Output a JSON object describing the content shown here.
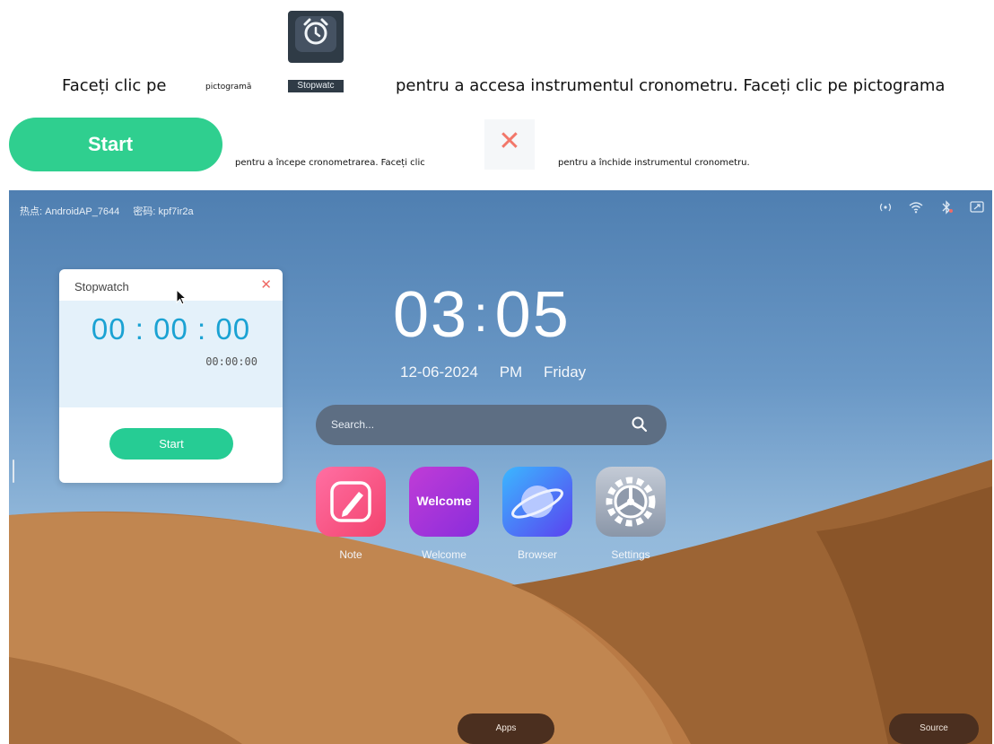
{
  "instructions": {
    "line1_a": "Faceți clic pe",
    "line1_small": "pictogramă",
    "line1_icon_label": "Stopwatc",
    "line1_b": "pentru a accesa instrumentul cronometru. Faceți clic pe pictograma",
    "start_button": "Start",
    "line2_a": "pentru a începe cronometrarea. Faceți clic",
    "line2_b": "pentru a închide instrumentul cronometru.",
    "close_symbol": "✕"
  },
  "statusbar": {
    "hotspot": "热点: AndroidAP_7644",
    "password": "密码: kpf7ir2a",
    "icons": [
      "hotspot-icon",
      "wifi-icon",
      "bluetooth-icon",
      "screen-share-icon"
    ]
  },
  "stopwatch": {
    "title": "Stopwatch",
    "close": "✕",
    "time": "00 : 00 : 00",
    "sub_time": "00:00:00",
    "start": "Start"
  },
  "home": {
    "clock_hours": "03",
    "clock_colon": ":",
    "clock_minutes": "05",
    "date": "12-06-2024",
    "ampm": "PM",
    "weekday": "Friday",
    "search_placeholder": "Search...",
    "apps": [
      {
        "label": "Note",
        "icon": "note-pen-icon"
      },
      {
        "label": "Welcome",
        "icon": "welcome-icon",
        "tile_text": "Welcome"
      },
      {
        "label": "Browser",
        "icon": "planet-browser-icon"
      },
      {
        "label": "Settings",
        "icon": "gear-icon"
      }
    ],
    "apps_button": "Apps",
    "source_button": "Source"
  },
  "colors": {
    "accent_green": "#26cc94",
    "stopwatch_digits": "#1ba2d3",
    "close_red": "#ef6b66"
  }
}
